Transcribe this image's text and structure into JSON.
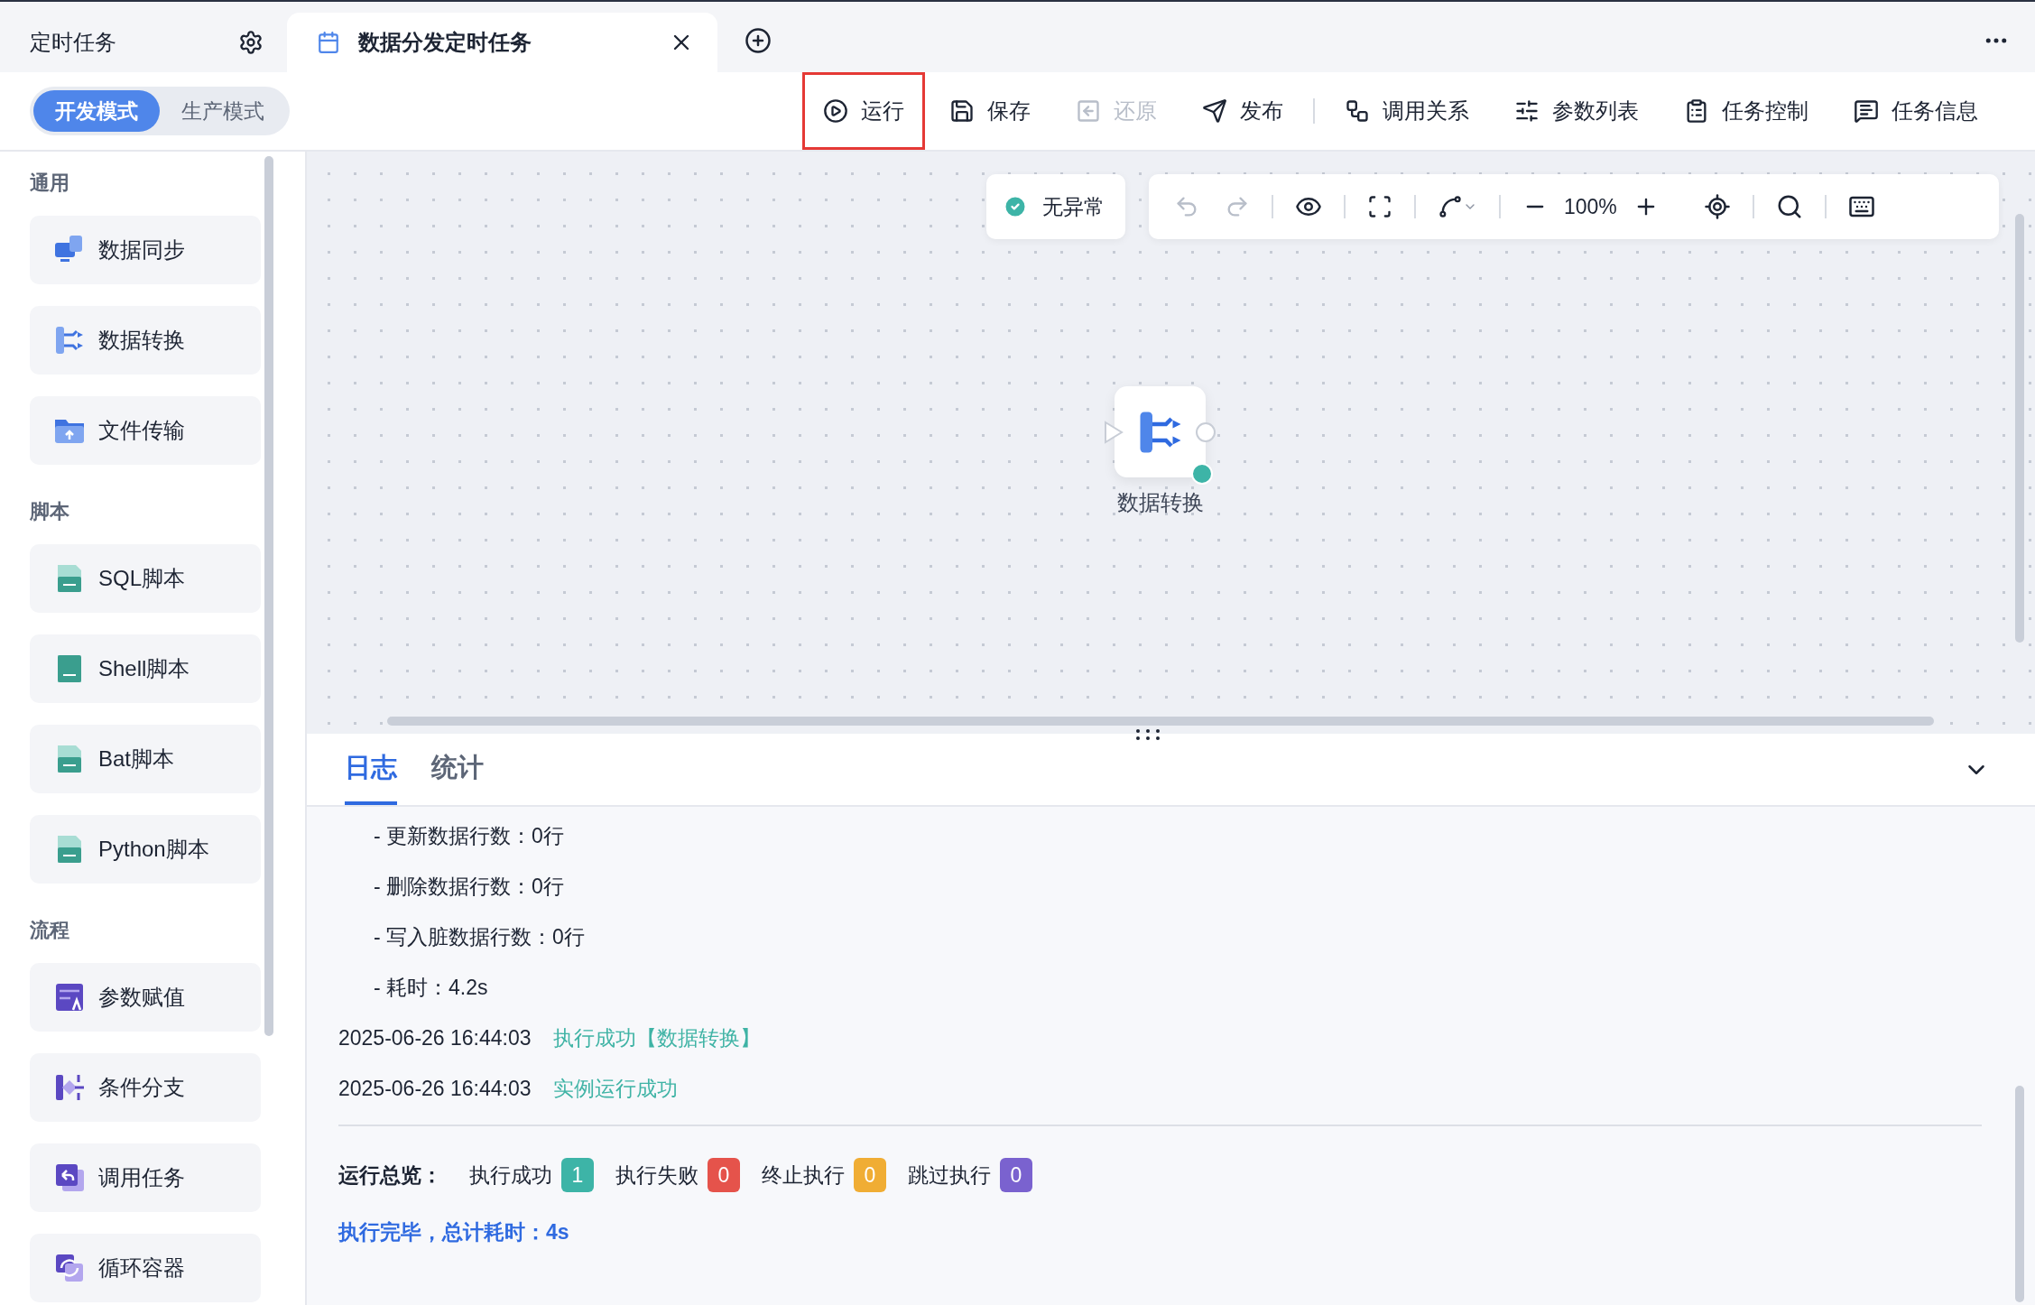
{
  "tabs": [
    {
      "label": "定时任务",
      "selected": false
    },
    {
      "label": "数据分发定时任务",
      "selected": true
    }
  ],
  "mode_switch": [
    {
      "label": "开发模式",
      "selected": true
    },
    {
      "label": "生产模式",
      "selected": false
    }
  ],
  "toolbar": [
    {
      "label": "运行",
      "highlighted": true,
      "disabled": false,
      "divider_before": false
    },
    {
      "label": "保存",
      "highlighted": false,
      "disabled": false,
      "divider_before": false
    },
    {
      "label": "还原",
      "highlighted": false,
      "disabled": true,
      "divider_before": false
    },
    {
      "label": "发布",
      "highlighted": false,
      "disabled": false,
      "divider_before": false
    },
    {
      "label": "调用关系",
      "highlighted": false,
      "disabled": false,
      "divider_before": true
    },
    {
      "label": "参数列表",
      "highlighted": false,
      "disabled": false,
      "divider_before": false
    },
    {
      "label": "任务控制",
      "highlighted": false,
      "disabled": false,
      "divider_before": false
    },
    {
      "label": "任务信息",
      "highlighted": false,
      "disabled": false,
      "divider_before": false
    }
  ],
  "sidebar": {
    "groups": [
      {
        "title": "通用",
        "items": [
          "数据同步",
          "数据转换",
          "文件传输"
        ]
      },
      {
        "title": "脚本",
        "items": [
          "SQL脚本",
          "Shell脚本",
          "Bat脚本",
          "Python脚本"
        ]
      },
      {
        "title": "流程",
        "items": [
          "参数赋值",
          "条件分支",
          "调用任务",
          "循环容器"
        ]
      }
    ]
  },
  "canvas": {
    "check_status": "无异常",
    "undo_disabled": true,
    "redo_disabled": true,
    "zoom": "100%",
    "node": {
      "label": "数据转换",
      "succeeded": true
    }
  },
  "log_panel": {
    "tabs": [
      {
        "label": "日志",
        "selected": true
      },
      {
        "label": "统计",
        "selected": false
      }
    ],
    "lines": [
      {
        "kind": "detail",
        "text": "- 更新数据行数：0行"
      },
      {
        "kind": "detail",
        "text": "- 删除数据行数：0行"
      },
      {
        "kind": "detail",
        "text": "- 写入脏数据行数：0行"
      },
      {
        "kind": "detail",
        "text": "- 耗时：4.2s"
      },
      {
        "kind": "event",
        "time": "2025-06-26 16:44:03",
        "message": "执行成功【数据转换】"
      },
      {
        "kind": "event",
        "time": "2025-06-26 16:44:03",
        "message": "实例运行成功"
      }
    ],
    "summary": {
      "label": "运行总览：",
      "counts": [
        {
          "label": "执行成功",
          "value": "1",
          "color": "#3db4a7"
        },
        {
          "label": "执行失败",
          "value": "0",
          "color": "#e5534b"
        },
        {
          "label": "终止执行",
          "value": "0",
          "color": "#f0ad34"
        },
        {
          "label": "跳过执行",
          "value": "0",
          "color": "#7a62cf"
        }
      ]
    },
    "footer": "执行完毕，总计耗时：4s"
  }
}
